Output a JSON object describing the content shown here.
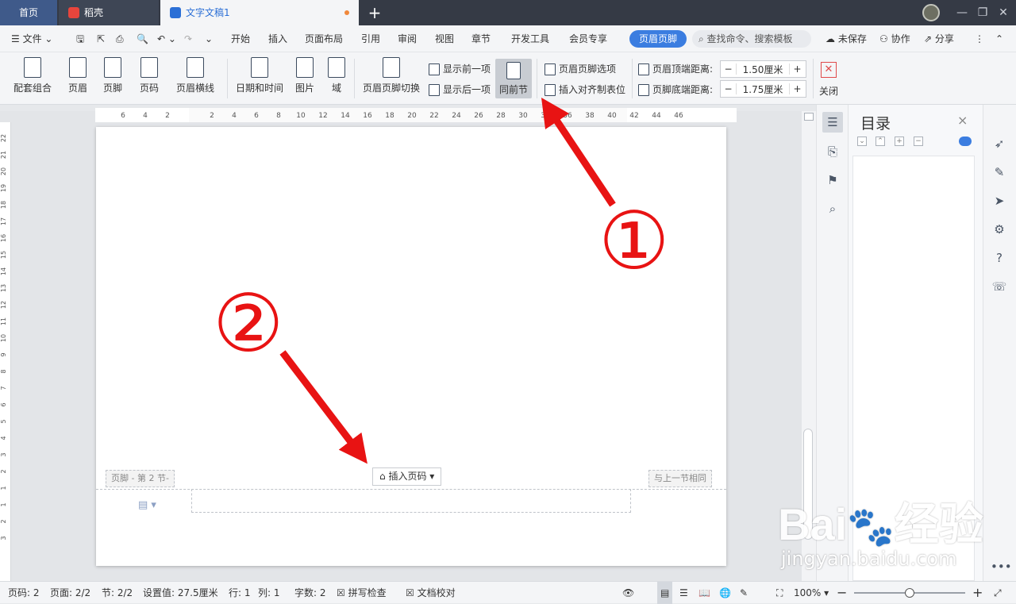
{
  "tabs": {
    "home": "首页",
    "daoke": "稻壳",
    "doc": "文字文稿1",
    "new_tab": "+"
  },
  "menubar": {
    "file": "文件",
    "items": [
      "开始",
      "插入",
      "页面布局",
      "引用",
      "审阅",
      "视图",
      "章节",
      "开发工具",
      "会员专享"
    ],
    "active": "页眉页脚",
    "search": "查找命令、搜索模板",
    "unsaved": "未保存",
    "collab": "协作",
    "share": "分享"
  },
  "ribbon": {
    "peitao": "配套组合",
    "header": "页眉",
    "footer": "页脚",
    "pagenum": "页码",
    "header_line": "页眉横线",
    "datetime": "日期和时间",
    "picture": "图片",
    "field": "域",
    "switch": "页眉页脚切换",
    "show_prev": "显示前一项",
    "show_next": "显示后一项",
    "same_as_prev": "同前节",
    "hf_options": "页眉页脚选项",
    "insert_tab": "插入对齐制表位",
    "header_top_label": "页眉顶端距离:",
    "header_top_value": "1.50厘米",
    "footer_bottom_label": "页脚底端距离:",
    "footer_bottom_value": "1.75厘米",
    "close": "关闭"
  },
  "ruler": {
    "h_ticks": [
      "6",
      "4",
      "2",
      "2",
      "4",
      "6",
      "8",
      "10",
      "12",
      "14",
      "16",
      "18",
      "20",
      "22",
      "24",
      "26",
      "28",
      "30",
      "34",
      "36",
      "38",
      "40",
      "42",
      "44",
      "46"
    ],
    "v_ticks": [
      "22",
      "21",
      "20",
      "19",
      "18",
      "17",
      "16",
      "15",
      "14",
      "13",
      "12",
      "11",
      "10",
      "9",
      "8",
      "7",
      "6",
      "5",
      "4",
      "3",
      "2",
      "1",
      "1",
      "2",
      "3"
    ]
  },
  "document": {
    "footer_label": "页脚 - 第 2 节-",
    "insert_page_number": "插入页码",
    "same_as_prev_label": "与上一节相同"
  },
  "toc": {
    "title": "目录",
    "close": "×"
  },
  "status": {
    "page": "页码: 2",
    "pages": "页面: 2/2",
    "section": "节: 2/2",
    "setting": "设置值: 27.5厘米",
    "row": "行: 1",
    "col": "列: 1",
    "words": "字数: 2",
    "spell": "拼写检查",
    "proof": "文档校对",
    "zoom": "100%"
  },
  "annotations": {
    "marker1": "①",
    "marker2": "②",
    "arrow_color": "#e81313"
  },
  "watermark": {
    "brand": "Bai",
    "brand_cn": "经验",
    "url": "jingyan.baidu.com"
  },
  "colors": {
    "accent": "#3b7de0",
    "titlebar": "#353a45"
  }
}
